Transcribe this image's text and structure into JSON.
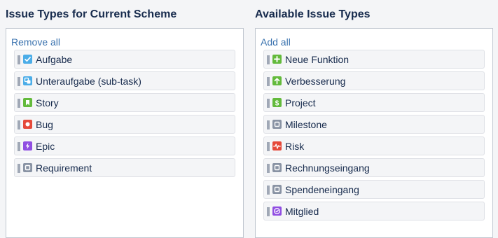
{
  "left": {
    "title": "Issue Types for Current Scheme",
    "action": "Remove all",
    "items": [
      {
        "label": "Aufgabe",
        "icon": "task-checkbox-icon",
        "color": "#4bade8"
      },
      {
        "label": "Unteraufgabe (sub-task)",
        "icon": "subtask-icon",
        "color": "#4bade8"
      },
      {
        "label": "Story",
        "icon": "story-bookmark-icon",
        "color": "#63ba3c"
      },
      {
        "label": "Bug",
        "icon": "bug-icon",
        "color": "#e5493a"
      },
      {
        "label": "Epic",
        "icon": "epic-lightning-icon",
        "color": "#904ee2"
      },
      {
        "label": "Requirement",
        "icon": "generic-issue-icon",
        "color": "#8993a4"
      }
    ]
  },
  "right": {
    "title": "Available Issue Types",
    "action": "Add all",
    "items": [
      {
        "label": "Neue Funktion",
        "icon": "new-feature-plus-icon",
        "color": "#63ba3c"
      },
      {
        "label": "Verbesserung",
        "icon": "improvement-arrow-up-icon",
        "color": "#63ba3c"
      },
      {
        "label": "Project",
        "icon": "project-dollar-icon",
        "color": "#63ba3c"
      },
      {
        "label": "Milestone",
        "icon": "generic-issue-icon",
        "color": "#8993a4"
      },
      {
        "label": "Risk",
        "icon": "risk-pulse-icon",
        "color": "#e5493a"
      },
      {
        "label": "Rechnungseingang",
        "icon": "generic-issue-icon",
        "color": "#8993a4"
      },
      {
        "label": "Spendeneingang",
        "icon": "generic-issue-icon",
        "color": "#8993a4"
      },
      {
        "label": "Mitglied",
        "icon": "member-check-circle-icon",
        "color": "#904ee2"
      }
    ]
  }
}
